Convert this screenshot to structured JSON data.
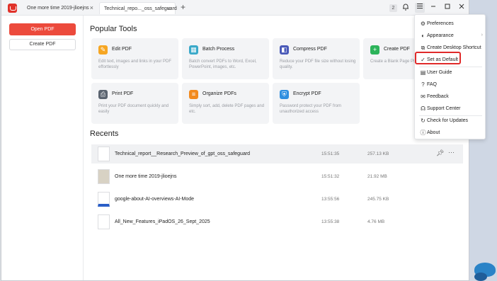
{
  "titlebar": {
    "tabs": [
      {
        "label": "One more time 2019-jlioejns"
      },
      {
        "label": "Technical_repo..._oss_safeguard"
      }
    ],
    "badge": "2"
  },
  "sidebar": {
    "open_pdf": "Open PDF",
    "create_pdf": "Create PDF"
  },
  "popular": {
    "title": "Popular Tools",
    "tools": [
      {
        "title": "Edit PDF",
        "desc": "Edit text, images and links in your PDF effortlessly",
        "color": "#f6a623"
      },
      {
        "title": "Batch Process",
        "desc": "Batch convert PDFs to Word, Excel, PowerPoint, images, etc.",
        "color": "#3aa9c9"
      },
      {
        "title": "Compress PDF",
        "desc": "Reduce your PDF file size without losing quality.",
        "color": "#4a5ab8"
      },
      {
        "title": "Create PDF",
        "desc": "Create a Blank Page PDF",
        "color": "#2cb35a"
      },
      {
        "title": "Print PDF",
        "desc": "Print your PDF document quickly and easily",
        "color": "#5b6470"
      },
      {
        "title": "Organize PDFs",
        "desc": "Simply sort, add, delete PDF pages and etc.",
        "color": "#f28a1e"
      },
      {
        "title": "Encrypt PDF",
        "desc": "Password protect your PDF from unauthorized access",
        "color": "#2f8fe0"
      }
    ]
  },
  "recents": {
    "title": "Recents",
    "files": [
      {
        "name": "Technical_report__Research_Preview_of_gpt_oss_safeguard",
        "time": "15:51:35",
        "size": "257.13 KB"
      },
      {
        "name": "One more time 2019-jlioejns",
        "time": "15:51:32",
        "size": "21.92 MB"
      },
      {
        "name": "google-about-AI-overviews-AI-Mode",
        "time": "13:55:56",
        "size": "245.75 KB"
      },
      {
        "name": "All_New_Features_iPadOS_26_Sept_2025",
        "time": "13:55:38",
        "size": "4.76 MB"
      }
    ]
  },
  "menu": {
    "items": [
      {
        "label": "Preferences",
        "icon": "gear-icon"
      },
      {
        "label": "Appearance",
        "icon": "palette-icon"
      },
      {
        "label": "Create Desktop Shortcut",
        "icon": "shortcut-icon"
      },
      {
        "label": "Set as Default",
        "icon": "check-circle-icon"
      },
      {
        "label": "User Guide",
        "icon": "book-icon"
      },
      {
        "label": "FAQ",
        "icon": "question-icon"
      },
      {
        "label": "Feedback",
        "icon": "feedback-icon"
      },
      {
        "label": "Support Center",
        "icon": "headset-icon"
      },
      {
        "label": "Check for Updates",
        "icon": "update-icon"
      },
      {
        "label": "About",
        "icon": "info-icon"
      }
    ]
  },
  "colors": {
    "accent": "#ec4a3c",
    "highlight": "#e02a2a"
  }
}
